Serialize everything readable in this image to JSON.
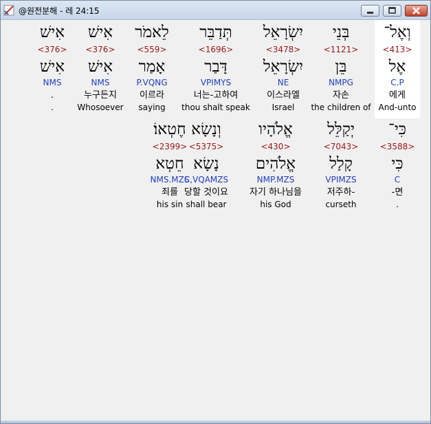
{
  "window": {
    "title": "@원전분해 - 레 24:15"
  },
  "rows": [
    [
      {
        "surface": "וְאֶל־",
        "strong": "<413>",
        "lemma": "אֶל",
        "parse": "C.P",
        "korean": "에게",
        "english": "And-unto"
      },
      {
        "surface": "בְּנֵי",
        "strong": "<1121>",
        "lemma": "בֵּן",
        "parse": "NMPG",
        "korean": "자손",
        "english": "the children of"
      },
      {
        "surface": "יִשְׂרָאֵל",
        "strong": "<3478>",
        "lemma": "יִשְׂרָאֵל",
        "parse": "NE",
        "korean": "이스라엘",
        "english": "Israel"
      },
      {
        "surface": "תְּדַבֵּר",
        "strong": "<1696>",
        "lemma": "דָּבַר",
        "parse": "VPIMYS",
        "korean": "너는-고하여",
        "english": "thou shalt speak"
      },
      {
        "surface": "לֵאמֹר",
        "strong": "<559>",
        "lemma": "אָמַר",
        "parse": "P.VQNG",
        "korean": "이르라",
        "english": "saying"
      },
      {
        "surface": "אִישׁ",
        "strong": "<376>",
        "lemma": "אִישׁ",
        "parse": "NMS",
        "korean": "누구든지",
        "english": "Whosoever"
      },
      {
        "surface": "אִישׁ",
        "strong": "<376>",
        "lemma": "אִישׁ",
        "parse": "NMS",
        "korean": ".",
        "english": "."
      }
    ],
    [
      {
        "surface": "כִּי־",
        "strong": "<3588>",
        "lemma": "כִּי",
        "parse": "C",
        "korean": "-면",
        "english": "."
      },
      {
        "surface": "יְקַלֵּל",
        "strong": "<7043>",
        "lemma": "קָלַל",
        "parse": "VPIMZS",
        "korean": "저주하-",
        "english": "curseth"
      },
      {
        "surface": "אֱלֹהָיו",
        "strong": "<430>",
        "lemma": "אֱלֹהִים",
        "parse": "NMP.MZS",
        "korean": "자기 하나님을",
        "english": "his God"
      },
      {
        "surface": "וְנָשָׂא",
        "strong": "<5375>",
        "lemma": "נָשָׂא",
        "parse": "C,VQAMZS",
        "korean": "당할 것이요",
        "english": "shall bear"
      },
      {
        "surface": "חֶטְאוֹ׃",
        "strong": "<2399>",
        "lemma": "חֵטְא",
        "parse": "NMS.MZS",
        "korean": "죄를",
        "english": "his sin"
      }
    ]
  ]
}
